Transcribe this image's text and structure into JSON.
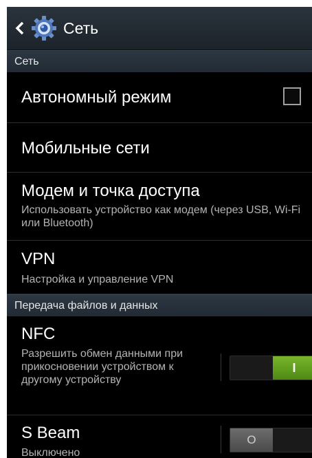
{
  "action_bar": {
    "title": "Сеть"
  },
  "sections": {
    "network": "Сеть",
    "transfer": "Передача файлов и данных"
  },
  "items": {
    "airplane": {
      "title": "Автономный режим",
      "checked": false
    },
    "mobile": {
      "title": "Мобильные сети"
    },
    "tethering": {
      "title": "Модем и точка доступа",
      "sub": "Использовать устройство как модем (через USB, Wi-Fi или Bluetooth)"
    },
    "vpn": {
      "title": "VPN",
      "sub": "Настройка и управление VPN"
    },
    "nfc": {
      "title": "NFC",
      "sub": "Разрешить обмен данными при прикосновении устройством к другому устройству",
      "toggle_on": true,
      "toggle_glyph": "I"
    },
    "sbeam": {
      "title": "S Beam",
      "sub": "Выключено",
      "toggle_on": false,
      "toggle_glyph": "O"
    }
  },
  "colors": {
    "toggle_on": "#5a9a1a",
    "background": "#000000",
    "section_bar": "#26303a"
  }
}
